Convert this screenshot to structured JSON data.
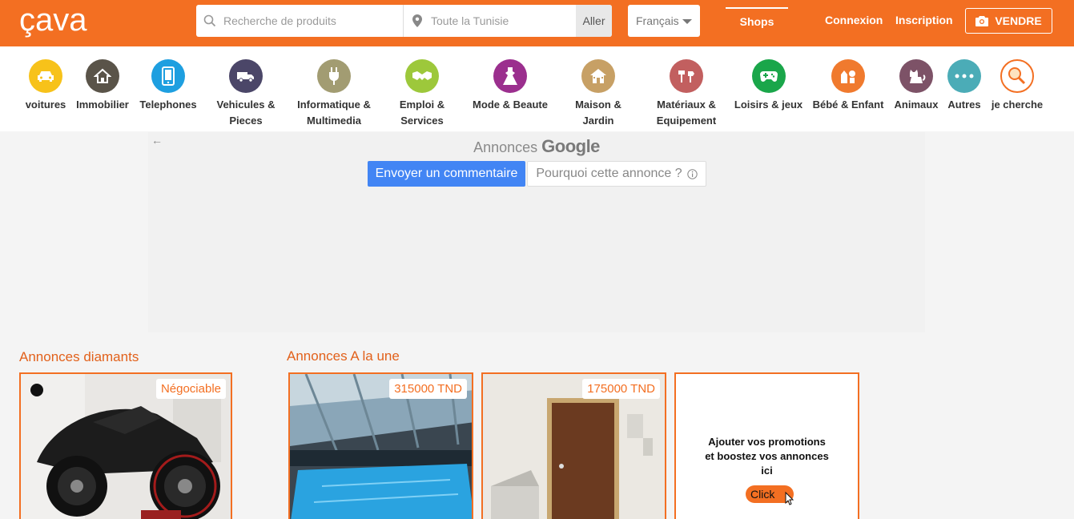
{
  "brand": {
    "logo_text": "çava",
    "accent": "#f36f22"
  },
  "search": {
    "placeholder": "Recherche de produits",
    "location_placeholder": "Toute la Tunisie",
    "submit": "Aller"
  },
  "language": {
    "selected": "Français"
  },
  "nav": {
    "shops": "Shops",
    "login": "Connexion",
    "register": "Inscription",
    "sell": "VENDRE"
  },
  "categories": [
    {
      "label": "voitures",
      "color": "#f7c21a",
      "icon": "car-icon"
    },
    {
      "label": "Immobilier",
      "color": "#5a5449",
      "icon": "house-icon"
    },
    {
      "label": "Telephones",
      "color": "#1e9fe0",
      "icon": "phone-icon"
    },
    {
      "label": "Vehicules &\nPieces",
      "color": "#4b4668",
      "icon": "truck-icon"
    },
    {
      "label": "Informatique &\nMultimedia",
      "color": "#a29c72",
      "icon": "plug-icon"
    },
    {
      "label": "Emploi &\nServices",
      "color": "#9dc83b",
      "icon": "handshake-icon"
    },
    {
      "label": "Mode & Beaute",
      "color": "#9b2f8e",
      "icon": "dress-icon"
    },
    {
      "label": "Maison &\nJardin",
      "color": "#c7a065",
      "icon": "home-garden-icon"
    },
    {
      "label": "Matériaux &\nEquipement",
      "color": "#c25f5f",
      "icon": "tools-icon"
    },
    {
      "label": "Loisirs & jeux",
      "color": "#1aa64a",
      "icon": "gamepad-icon"
    },
    {
      "label": "Bébé & Enfant",
      "color": "#f07a2e",
      "icon": "baby-icon"
    },
    {
      "label": "Animaux",
      "color": "#7d5267",
      "icon": "cat-icon"
    },
    {
      "label": "Autres",
      "color": "#4bacb7",
      "icon": "more-icon"
    },
    {
      "label": "je cherche",
      "color": "#ffffff",
      "icon": "magnifier-icon"
    }
  ],
  "ad": {
    "title_prefix": "Annonces",
    "title_brand": "Google",
    "feedback_button": "Envoyer un commentaire",
    "why_button": "Pourquoi cette annonce ?"
  },
  "sections": {
    "diamonds": "Annonces diamants",
    "featured": "Annonces A la une"
  },
  "diamond_listing": {
    "badge": "Négociable"
  },
  "featured_listings": [
    {
      "price": "315000 TND"
    },
    {
      "price": "175000 TND"
    }
  ],
  "promo": {
    "text": "Ajouter vos promotions\net boostez vos annonces\nici",
    "button": "Click"
  }
}
